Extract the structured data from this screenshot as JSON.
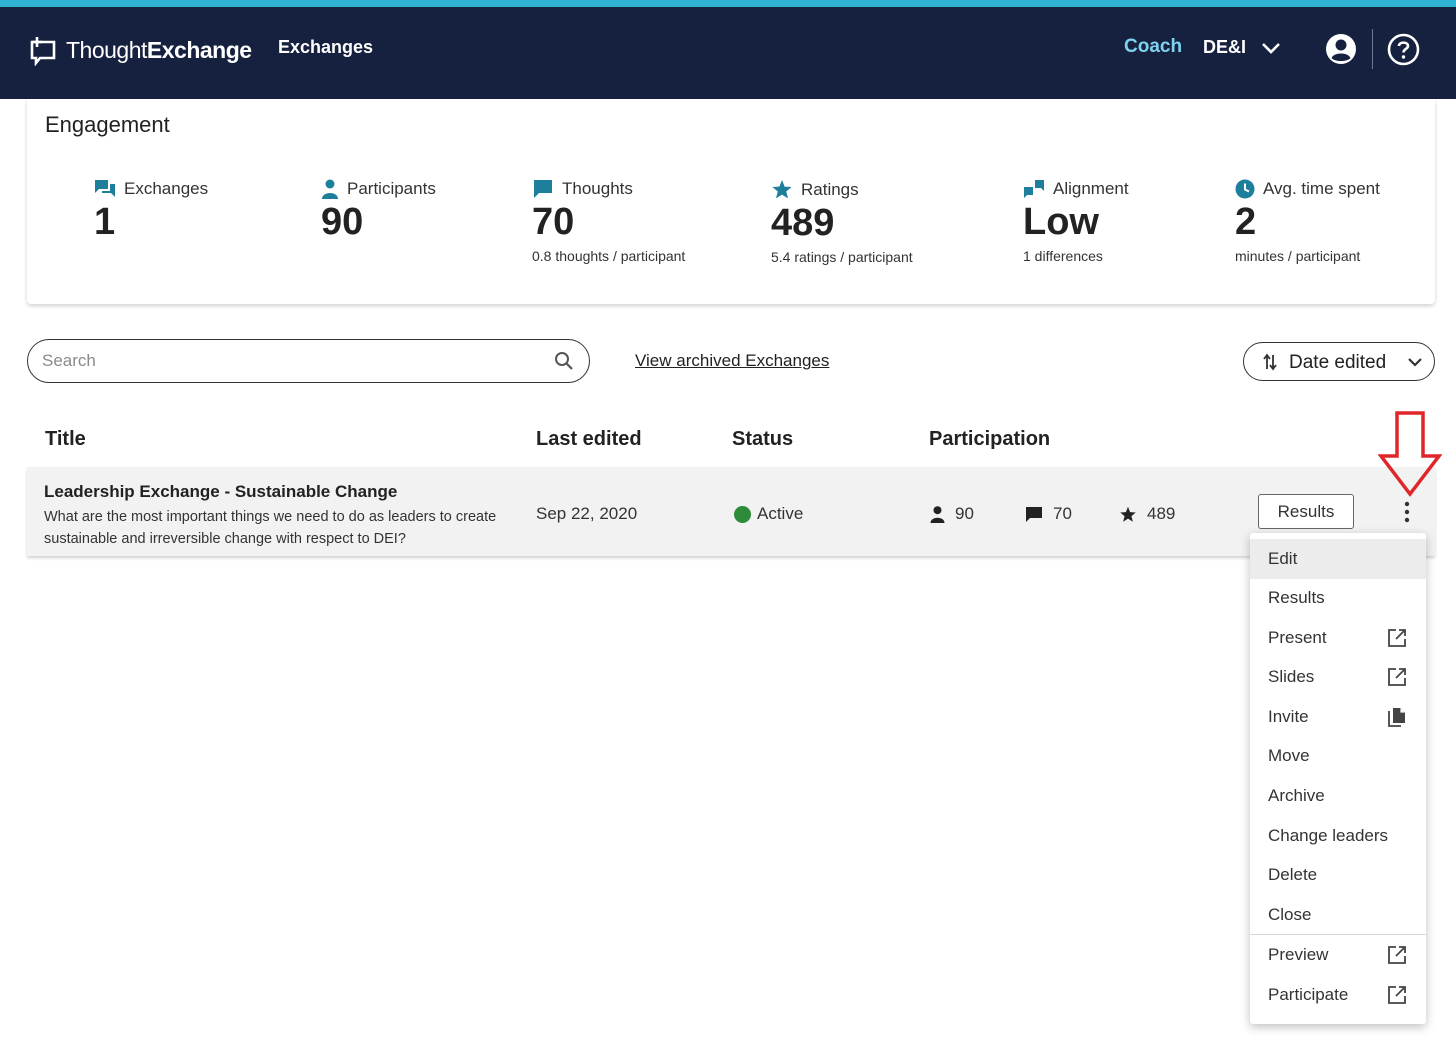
{
  "nav": {
    "logo_light": "Thought",
    "logo_bold": "Exchange",
    "exchanges": "Exchanges",
    "coach": "Coach",
    "org": "DE&I"
  },
  "engagement": {
    "title": "Engagement",
    "stats": [
      {
        "label": "Exchanges",
        "value": "1",
        "sub": "",
        "icon": "chat-bubbles-icon"
      },
      {
        "label": "Participants",
        "value": "90",
        "sub": "",
        "icon": "person-icon"
      },
      {
        "label": "Thoughts",
        "value": "70",
        "sub": "0.8 thoughts / participant",
        "icon": "chat-bubble-icon"
      },
      {
        "label": "Ratings",
        "value": "489",
        "sub": "5.4 ratings / participant",
        "icon": "star-icon"
      },
      {
        "label": "Alignment",
        "value": "Low",
        "sub": "1 differences",
        "icon": "alignment-icon"
      },
      {
        "label": "Avg. time spent",
        "value": "2",
        "sub": "minutes / participant",
        "icon": "clock-icon"
      }
    ]
  },
  "toolbar": {
    "search_placeholder": "Search",
    "archived_link": "View archived Exchanges",
    "sort_label": "Date edited"
  },
  "table": {
    "headers": [
      "Title",
      "Last edited",
      "Status",
      "Participation"
    ],
    "rows": [
      {
        "title": "Leadership Exchange - Sustainable Change",
        "description": "What are the most important things we need to do as leaders to create sustainable and irreversible change with respect to DEI?",
        "last_edited": "Sep 22, 2020",
        "status": "Active",
        "participants": "90",
        "thoughts": "70",
        "ratings": "489",
        "results_label": "Results"
      }
    ]
  },
  "menu": {
    "items": [
      "Edit",
      "Results",
      "Present",
      "Slides",
      "Invite",
      "Move",
      "Archive",
      "Change leaders",
      "Delete",
      "Close",
      "Preview",
      "Participate"
    ]
  },
  "colors": {
    "navbar": "#16213f",
    "accent_stripe": "#2fb2d4",
    "coach": "#7fd2ef",
    "icon_teal": "#1d7f9c",
    "active_green": "#2e8b3a",
    "annotation_red": "#e0262b"
  }
}
